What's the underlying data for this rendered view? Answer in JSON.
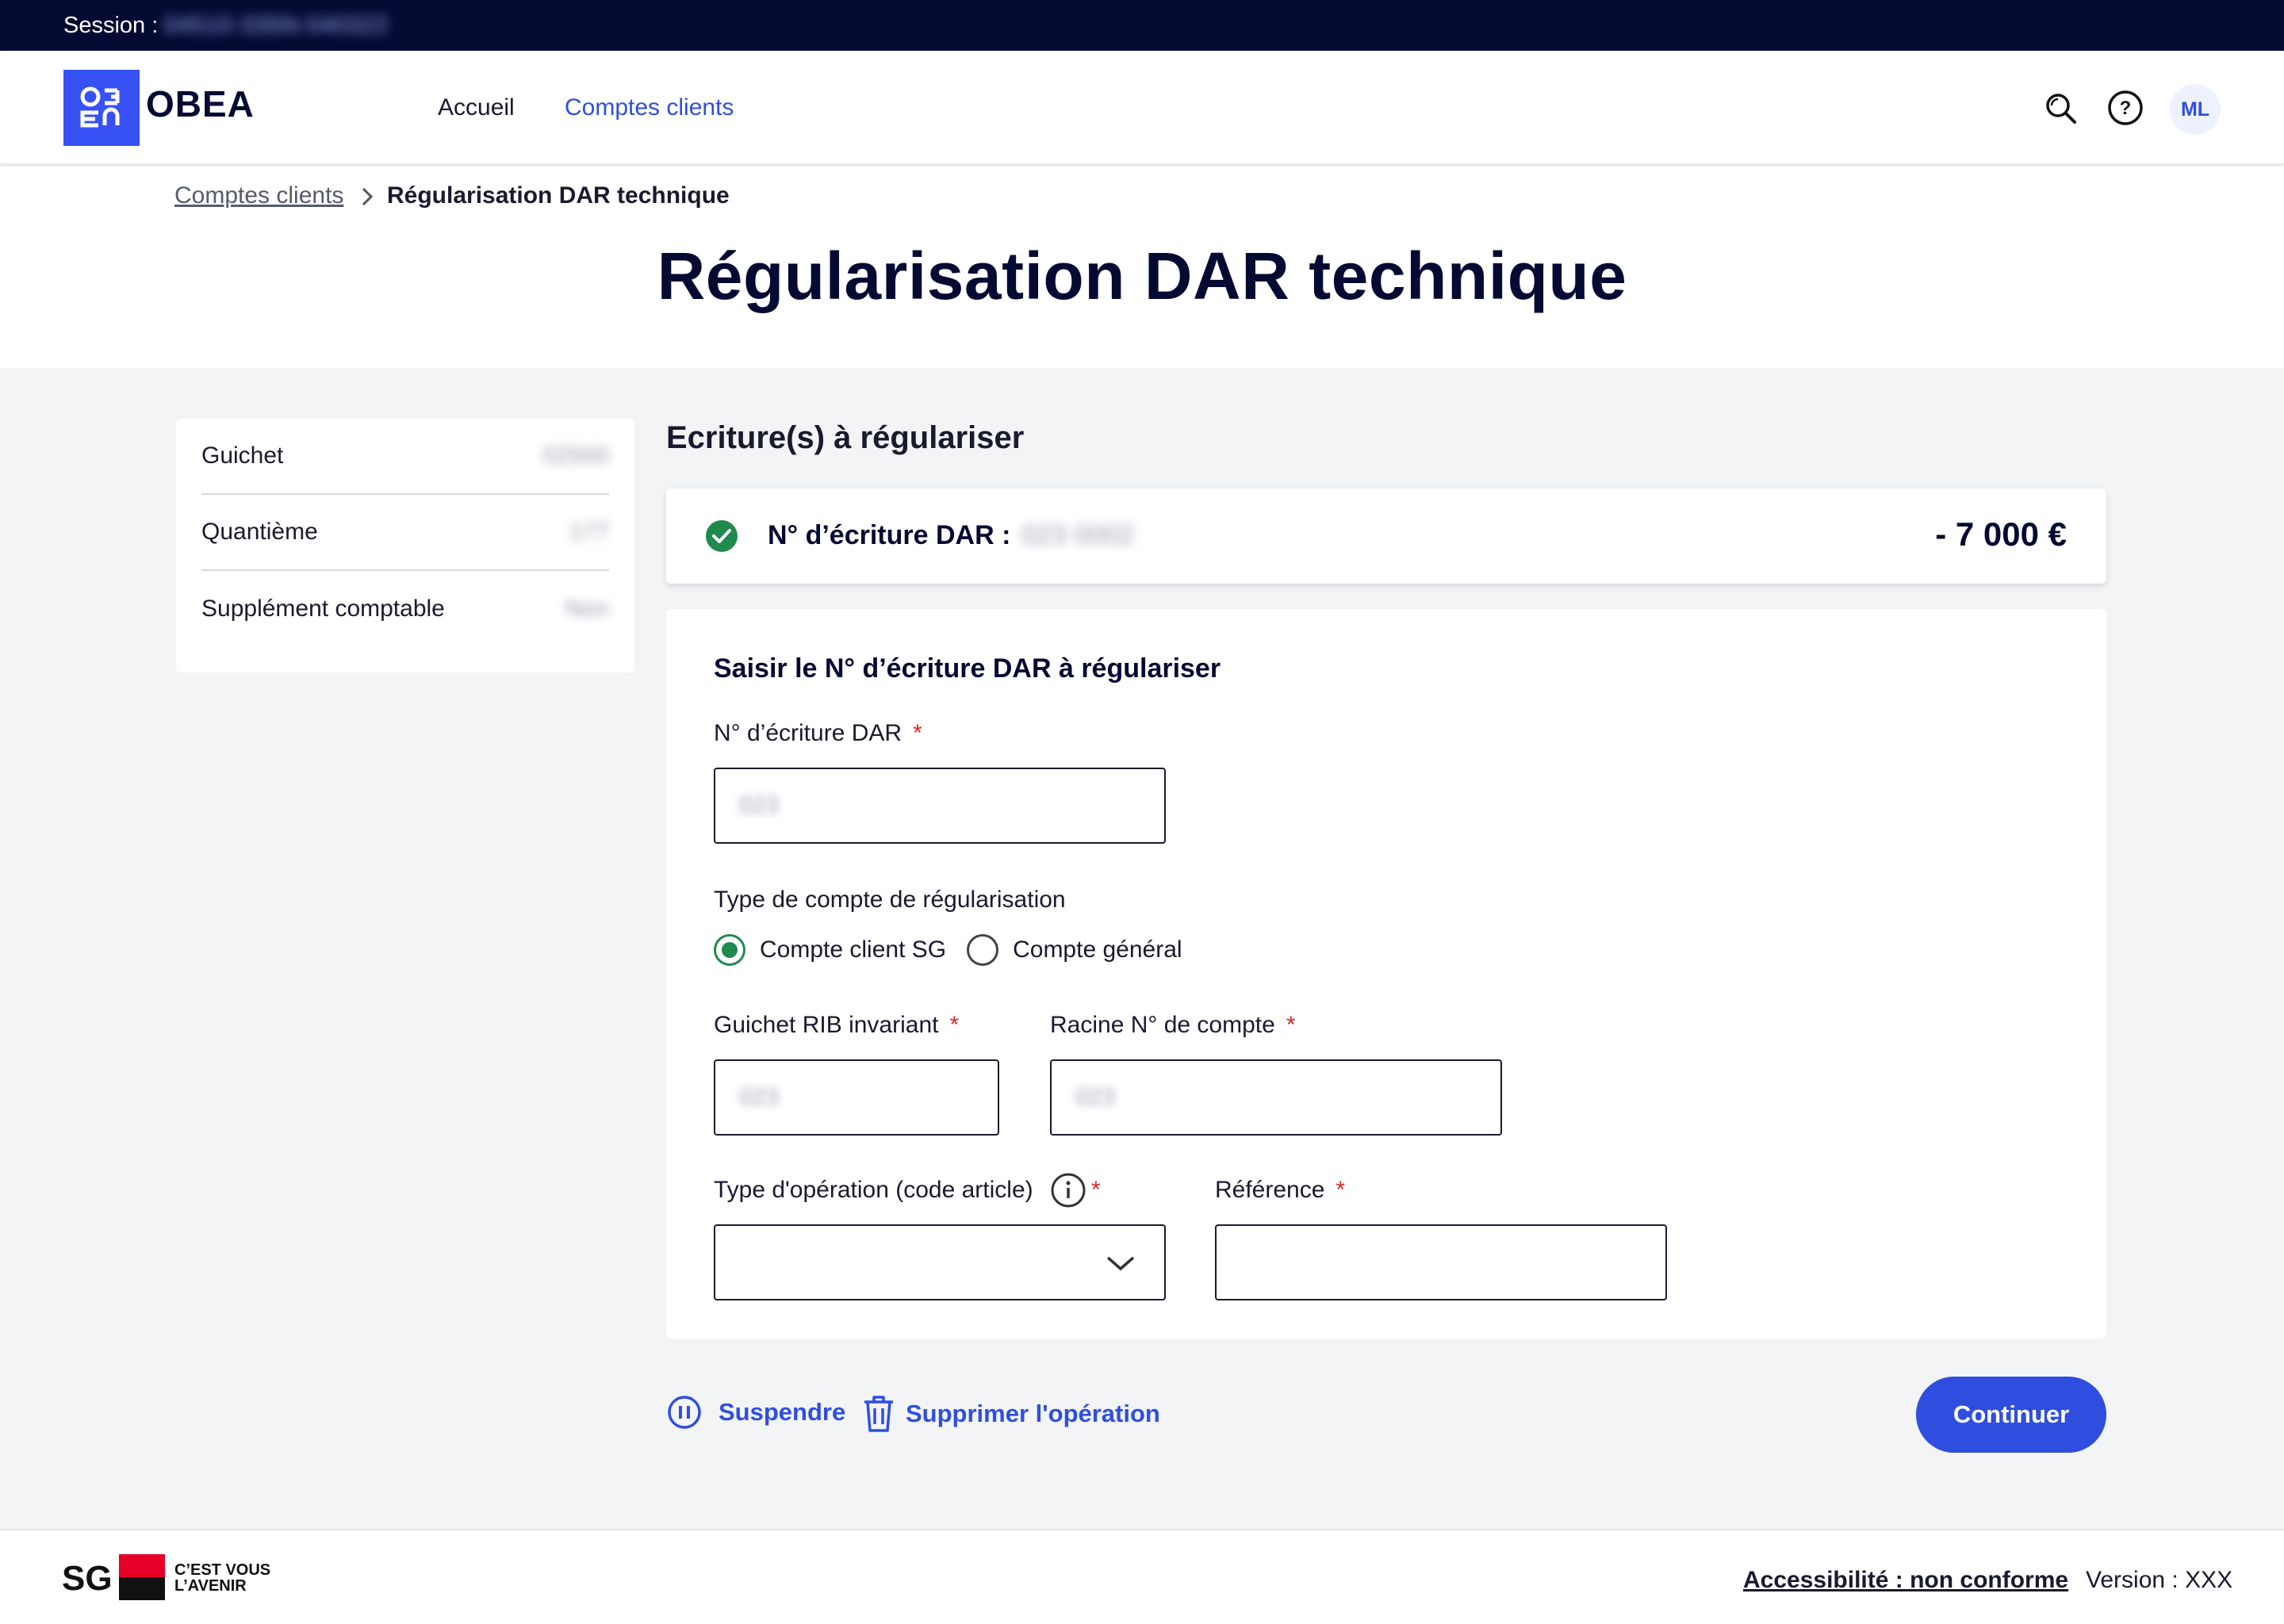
{
  "session": {
    "label": "Session :",
    "value": "04510-335N-040322"
  },
  "header": {
    "brand": "OBEA",
    "nav": {
      "home": "Accueil",
      "accounts": "Comptes clients"
    },
    "avatar_initials": "ML"
  },
  "breadcrumb": {
    "parent": "Comptes clients",
    "current": "Régularisation DAR technique"
  },
  "page_title": "Régularisation DAR technique",
  "info_card": [
    {
      "label": "Guichet",
      "value": "02500"
    },
    {
      "label": "Quantième",
      "value": "177"
    },
    {
      "label": "Supplément comptable",
      "value": "Non"
    }
  ],
  "section_title": "Ecriture(s) à régulariser",
  "dar_entry": {
    "label": "N° d’écriture DAR :",
    "number": "023 0002",
    "amount": "- 7 000 €",
    "status_color": "#1f8a4c"
  },
  "form": {
    "title": "Saisir le N° d’écriture DAR à régulariser",
    "dar_number": {
      "label": "N° d’écriture DAR",
      "required": "*",
      "placeholder": "023"
    },
    "account_type": {
      "label": "Type de compte de régularisation",
      "options": [
        "Compte client SG",
        "Compte général"
      ],
      "selected": "Compte client SG"
    },
    "guichet_rib": {
      "label": "Guichet RIB invariant",
      "required": "*",
      "placeholder": "023"
    },
    "racine": {
      "label": "Racine N° de compte",
      "required": "*",
      "placeholder": "023"
    },
    "operation_type": {
      "label": "Type d'opération (code article)",
      "required": "*",
      "value": ""
    },
    "reference": {
      "label": "Référence",
      "required": "*",
      "value": ""
    }
  },
  "actions": {
    "suspend": "Suspendre",
    "delete": "Supprimer l'opération",
    "continue": "Continuer"
  },
  "footer": {
    "brand": "SG",
    "slogan_line1": "C’EST VOUS",
    "slogan_line2": "L’AVENIR",
    "accessibility": "Accessibilité : non conforme",
    "version": "Version : XXX"
  },
  "colors": {
    "primary": "#2f4ee0",
    "navy": "#050a33",
    "success": "#1f8a4c",
    "required": "#d72a2a",
    "sg_red": "#e60028"
  }
}
